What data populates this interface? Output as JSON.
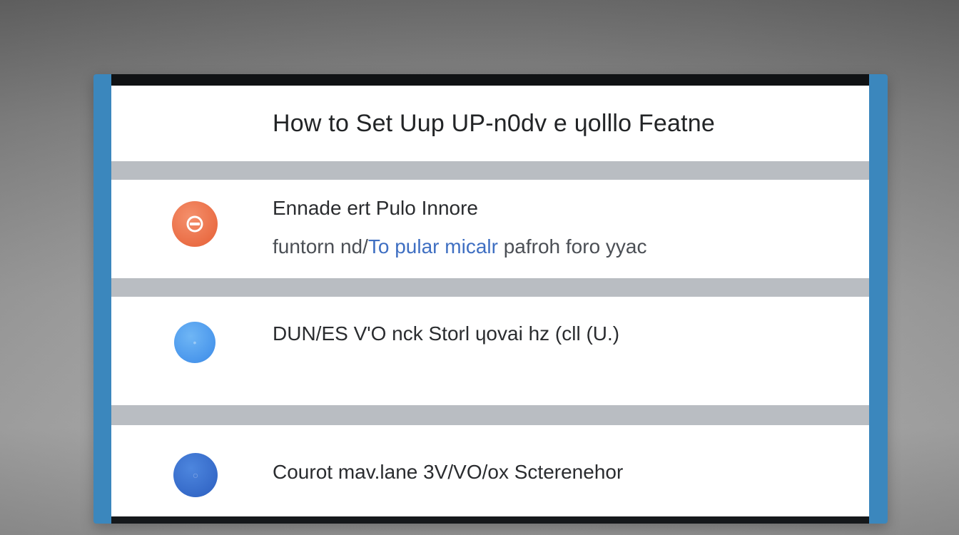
{
  "header": {
    "title": "How to Set Uup UP-n0dv e ɥolllo Featne"
  },
  "steps": [
    {
      "icon": "badge-icon",
      "color": "#ea6d45",
      "title": "Ennade ert Pulo Innore",
      "subtitle_plain": "funtorn nd/",
      "subtitle_link": "To pular micalr",
      "subtitle_rest": " pafroh foro yyac"
    },
    {
      "icon": "circle-icon",
      "color": "#4a97ec",
      "title": "DUN/ES V'O nck Storl ɥovai hz (cll (U.)"
    },
    {
      "icon": "circle-icon",
      "color": "#3468c7",
      "title": "Courot mav.lane 3V/VO/ox Scterenehor"
    }
  ],
  "colors": {
    "frame": "#3b87bd",
    "separator": "#b9bdc2",
    "link": "#3f6fc2"
  }
}
